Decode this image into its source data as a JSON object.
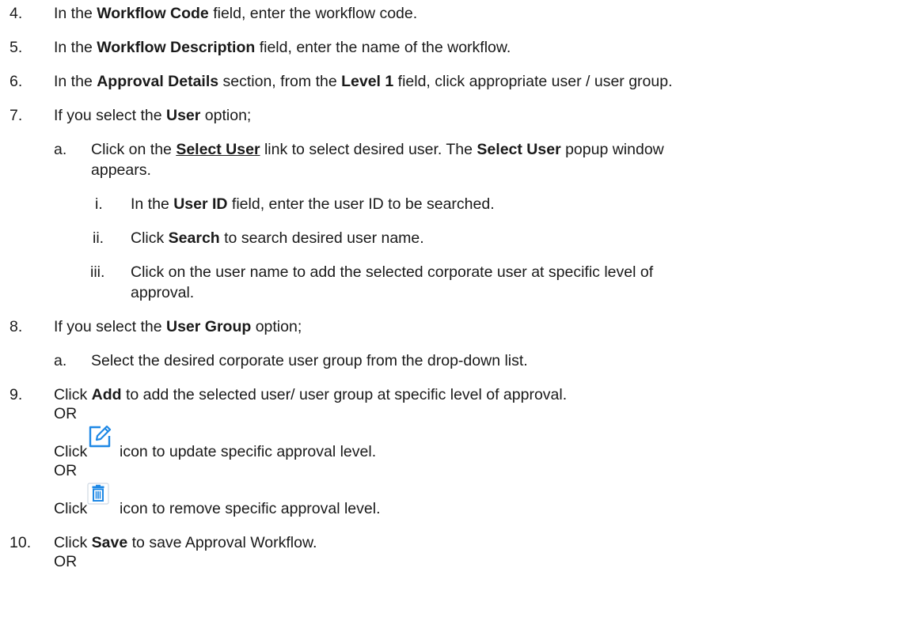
{
  "steps": {
    "s4": {
      "num": "4.",
      "a": "In the ",
      "b": "Workflow Code",
      "c": " field, enter the workflow code."
    },
    "s5": {
      "num": "5.",
      "a": "In the ",
      "b": "Workflow Description",
      "c": " field, enter the name of the workflow."
    },
    "s6": {
      "num": "6.",
      "a": "In the ",
      "b": "Approval Details",
      "c": " section, from the ",
      "d": "Level 1",
      "e": " field, click appropriate user / user group."
    },
    "s7": {
      "num": "7.",
      "a": "If you select the ",
      "b": "User",
      "c": " option;"
    },
    "s7a": {
      "num": "a.",
      "a": "Click on the ",
      "b": "Select User",
      "c": " link to select desired user. The ",
      "d": "Select User",
      "e": " popup window",
      "line2": "appears."
    },
    "s7ai": {
      "num": "i.",
      "a": "In the ",
      "b": "User ID",
      "c": " field, enter the user ID to be searched."
    },
    "s7aii": {
      "num": "ii.",
      "a": "Click ",
      "b": "Search",
      "c": " to search desired user name."
    },
    "s7aiii": {
      "num": "iii.",
      "line1": "Click on the user name to add the selected corporate user at specific level of",
      "line2": "approval."
    },
    "s8": {
      "num": "8.",
      "a": "If you select the ",
      "b": "User Group",
      "c": " option;"
    },
    "s8a": {
      "num": "a.",
      "text": "Select the desired corporate user group from the drop-down list."
    },
    "s9": {
      "num": "9.",
      "a": "Click ",
      "b": "Add",
      "c": " to add the selected user/ user group at specific level of approval.",
      "or1": "OR",
      "edit_a": "Click",
      "edit_b": "icon to update specific approval level.",
      "or2": "OR",
      "del_a": "Click",
      "del_b": "icon to remove specific approval level."
    },
    "s10": {
      "num": "10.",
      "a": "Click ",
      "b": "Save",
      "c": " to save Approval Workflow.",
      "or": "OR"
    }
  },
  "icons": {
    "edit": "edit-icon",
    "delete": "trash-icon",
    "color": "#1e88e5"
  }
}
